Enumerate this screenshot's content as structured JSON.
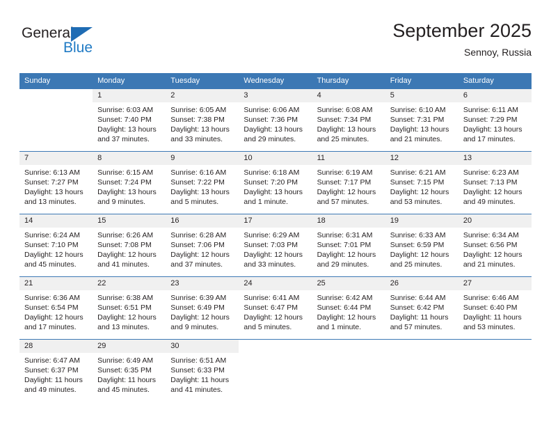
{
  "brand": {
    "name_part1": "General",
    "name_part2": "Blue",
    "triangle_icon": "triangle-icon",
    "color_dark": "#231f20",
    "color_blue": "#1f7ac4"
  },
  "header": {
    "title": "September 2025",
    "subtitle": "Sennoy, Russia"
  },
  "theme": {
    "header_bg": "#3c78b4",
    "header_text": "#ffffff",
    "daynum_bg": "#f0f0f0",
    "row_border": "#3c78b4",
    "body_text": "#231f20"
  },
  "calendar": {
    "weekday_headers": [
      "Sunday",
      "Monday",
      "Tuesday",
      "Wednesday",
      "Thursday",
      "Friday",
      "Saturday"
    ],
    "weeks": [
      [
        {
          "day": "",
          "sunrise": "",
          "sunset": "",
          "daylight_line1": "",
          "daylight_line2": ""
        },
        {
          "day": "1",
          "sunrise": "Sunrise: 6:03 AM",
          "sunset": "Sunset: 7:40 PM",
          "daylight_line1": "Daylight: 13 hours",
          "daylight_line2": "and 37 minutes."
        },
        {
          "day": "2",
          "sunrise": "Sunrise: 6:05 AM",
          "sunset": "Sunset: 7:38 PM",
          "daylight_line1": "Daylight: 13 hours",
          "daylight_line2": "and 33 minutes."
        },
        {
          "day": "3",
          "sunrise": "Sunrise: 6:06 AM",
          "sunset": "Sunset: 7:36 PM",
          "daylight_line1": "Daylight: 13 hours",
          "daylight_line2": "and 29 minutes."
        },
        {
          "day": "4",
          "sunrise": "Sunrise: 6:08 AM",
          "sunset": "Sunset: 7:34 PM",
          "daylight_line1": "Daylight: 13 hours",
          "daylight_line2": "and 25 minutes."
        },
        {
          "day": "5",
          "sunrise": "Sunrise: 6:10 AM",
          "sunset": "Sunset: 7:31 PM",
          "daylight_line1": "Daylight: 13 hours",
          "daylight_line2": "and 21 minutes."
        },
        {
          "day": "6",
          "sunrise": "Sunrise: 6:11 AM",
          "sunset": "Sunset: 7:29 PM",
          "daylight_line1": "Daylight: 13 hours",
          "daylight_line2": "and 17 minutes."
        }
      ],
      [
        {
          "day": "7",
          "sunrise": "Sunrise: 6:13 AM",
          "sunset": "Sunset: 7:27 PM",
          "daylight_line1": "Daylight: 13 hours",
          "daylight_line2": "and 13 minutes."
        },
        {
          "day": "8",
          "sunrise": "Sunrise: 6:15 AM",
          "sunset": "Sunset: 7:24 PM",
          "daylight_line1": "Daylight: 13 hours",
          "daylight_line2": "and 9 minutes."
        },
        {
          "day": "9",
          "sunrise": "Sunrise: 6:16 AM",
          "sunset": "Sunset: 7:22 PM",
          "daylight_line1": "Daylight: 13 hours",
          "daylight_line2": "and 5 minutes."
        },
        {
          "day": "10",
          "sunrise": "Sunrise: 6:18 AM",
          "sunset": "Sunset: 7:20 PM",
          "daylight_line1": "Daylight: 13 hours",
          "daylight_line2": "and 1 minute."
        },
        {
          "day": "11",
          "sunrise": "Sunrise: 6:19 AM",
          "sunset": "Sunset: 7:17 PM",
          "daylight_line1": "Daylight: 12 hours",
          "daylight_line2": "and 57 minutes."
        },
        {
          "day": "12",
          "sunrise": "Sunrise: 6:21 AM",
          "sunset": "Sunset: 7:15 PM",
          "daylight_line1": "Daylight: 12 hours",
          "daylight_line2": "and 53 minutes."
        },
        {
          "day": "13",
          "sunrise": "Sunrise: 6:23 AM",
          "sunset": "Sunset: 7:13 PM",
          "daylight_line1": "Daylight: 12 hours",
          "daylight_line2": "and 49 minutes."
        }
      ],
      [
        {
          "day": "14",
          "sunrise": "Sunrise: 6:24 AM",
          "sunset": "Sunset: 7:10 PM",
          "daylight_line1": "Daylight: 12 hours",
          "daylight_line2": "and 45 minutes."
        },
        {
          "day": "15",
          "sunrise": "Sunrise: 6:26 AM",
          "sunset": "Sunset: 7:08 PM",
          "daylight_line1": "Daylight: 12 hours",
          "daylight_line2": "and 41 minutes."
        },
        {
          "day": "16",
          "sunrise": "Sunrise: 6:28 AM",
          "sunset": "Sunset: 7:06 PM",
          "daylight_line1": "Daylight: 12 hours",
          "daylight_line2": "and 37 minutes."
        },
        {
          "day": "17",
          "sunrise": "Sunrise: 6:29 AM",
          "sunset": "Sunset: 7:03 PM",
          "daylight_line1": "Daylight: 12 hours",
          "daylight_line2": "and 33 minutes."
        },
        {
          "day": "18",
          "sunrise": "Sunrise: 6:31 AM",
          "sunset": "Sunset: 7:01 PM",
          "daylight_line1": "Daylight: 12 hours",
          "daylight_line2": "and 29 minutes."
        },
        {
          "day": "19",
          "sunrise": "Sunrise: 6:33 AM",
          "sunset": "Sunset: 6:59 PM",
          "daylight_line1": "Daylight: 12 hours",
          "daylight_line2": "and 25 minutes."
        },
        {
          "day": "20",
          "sunrise": "Sunrise: 6:34 AM",
          "sunset": "Sunset: 6:56 PM",
          "daylight_line1": "Daylight: 12 hours",
          "daylight_line2": "and 21 minutes."
        }
      ],
      [
        {
          "day": "21",
          "sunrise": "Sunrise: 6:36 AM",
          "sunset": "Sunset: 6:54 PM",
          "daylight_line1": "Daylight: 12 hours",
          "daylight_line2": "and 17 minutes."
        },
        {
          "day": "22",
          "sunrise": "Sunrise: 6:38 AM",
          "sunset": "Sunset: 6:51 PM",
          "daylight_line1": "Daylight: 12 hours",
          "daylight_line2": "and 13 minutes."
        },
        {
          "day": "23",
          "sunrise": "Sunrise: 6:39 AM",
          "sunset": "Sunset: 6:49 PM",
          "daylight_line1": "Daylight: 12 hours",
          "daylight_line2": "and 9 minutes."
        },
        {
          "day": "24",
          "sunrise": "Sunrise: 6:41 AM",
          "sunset": "Sunset: 6:47 PM",
          "daylight_line1": "Daylight: 12 hours",
          "daylight_line2": "and 5 minutes."
        },
        {
          "day": "25",
          "sunrise": "Sunrise: 6:42 AM",
          "sunset": "Sunset: 6:44 PM",
          "daylight_line1": "Daylight: 12 hours",
          "daylight_line2": "and 1 minute."
        },
        {
          "day": "26",
          "sunrise": "Sunrise: 6:44 AM",
          "sunset": "Sunset: 6:42 PM",
          "daylight_line1": "Daylight: 11 hours",
          "daylight_line2": "and 57 minutes."
        },
        {
          "day": "27",
          "sunrise": "Sunrise: 6:46 AM",
          "sunset": "Sunset: 6:40 PM",
          "daylight_line1": "Daylight: 11 hours",
          "daylight_line2": "and 53 minutes."
        }
      ],
      [
        {
          "day": "28",
          "sunrise": "Sunrise: 6:47 AM",
          "sunset": "Sunset: 6:37 PM",
          "daylight_line1": "Daylight: 11 hours",
          "daylight_line2": "and 49 minutes."
        },
        {
          "day": "29",
          "sunrise": "Sunrise: 6:49 AM",
          "sunset": "Sunset: 6:35 PM",
          "daylight_line1": "Daylight: 11 hours",
          "daylight_line2": "and 45 minutes."
        },
        {
          "day": "30",
          "sunrise": "Sunrise: 6:51 AM",
          "sunset": "Sunset: 6:33 PM",
          "daylight_line1": "Daylight: 11 hours",
          "daylight_line2": "and 41 minutes."
        },
        {
          "day": "",
          "sunrise": "",
          "sunset": "",
          "daylight_line1": "",
          "daylight_line2": ""
        },
        {
          "day": "",
          "sunrise": "",
          "sunset": "",
          "daylight_line1": "",
          "daylight_line2": ""
        },
        {
          "day": "",
          "sunrise": "",
          "sunset": "",
          "daylight_line1": "",
          "daylight_line2": ""
        },
        {
          "day": "",
          "sunrise": "",
          "sunset": "",
          "daylight_line1": "",
          "daylight_line2": ""
        }
      ]
    ]
  }
}
